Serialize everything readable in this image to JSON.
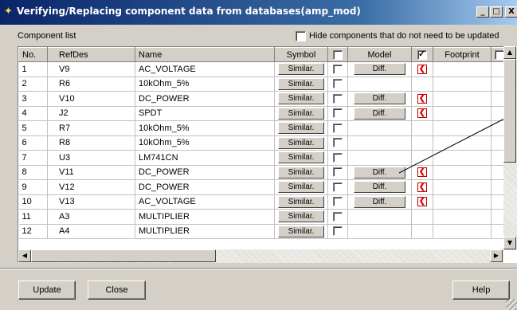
{
  "window": {
    "title": "Verifying/Replacing component data from databases(amp_mod)",
    "title_icon": "tools-icon",
    "minimize": "_",
    "maximize": "□",
    "close": "X"
  },
  "list_label": "Component list",
  "hide_checkbox_label": "Hide components that do not need to be updated",
  "columns": [
    "No.",
    "RefDes",
    "Name",
    "Symbol",
    "",
    "Model",
    "",
    "Footprint",
    ""
  ],
  "rows": [
    {
      "no": "1",
      "refdes": "V9",
      "name": "AC_VOLTAGE",
      "symbol": "Similar.",
      "model": "Diff.",
      "model_flag": true
    },
    {
      "no": "2",
      "refdes": "R6",
      "name": "10kOhm_5%",
      "symbol": "Similar.",
      "model": "",
      "model_flag": false
    },
    {
      "no": "3",
      "refdes": "V10",
      "name": "DC_POWER",
      "symbol": "Similar.",
      "model": "Diff.",
      "model_flag": true
    },
    {
      "no": "4",
      "refdes": "J2",
      "name": "SPDT",
      "symbol": "Similar.",
      "model": "Diff.",
      "model_flag": true
    },
    {
      "no": "5",
      "refdes": "R7",
      "name": "10kOhm_5%",
      "symbol": "Similar.",
      "model": "",
      "model_flag": false
    },
    {
      "no": "6",
      "refdes": "R8",
      "name": "10kOhm_5%",
      "symbol": "Similar.",
      "model": "",
      "model_flag": false
    },
    {
      "no": "7",
      "refdes": "U3",
      "name": "LM741CN",
      "symbol": "Similar.",
      "model": "",
      "model_flag": false
    },
    {
      "no": "8",
      "refdes": "V11",
      "name": "DC_POWER",
      "symbol": "Similar.",
      "model": "Diff.",
      "model_flag": true
    },
    {
      "no": "9",
      "refdes": "V12",
      "name": "DC_POWER",
      "symbol": "Similar.",
      "model": "Diff.",
      "model_flag": true
    },
    {
      "no": "10",
      "refdes": "V13",
      "name": "AC_VOLTAGE",
      "symbol": "Similar.",
      "model": "Diff.",
      "model_flag": true
    },
    {
      "no": "11",
      "refdes": "A3",
      "name": "MULTIPLIER",
      "symbol": "Similar.",
      "model": "",
      "model_flag": false
    },
    {
      "no": "12",
      "refdes": "A4",
      "name": "MULTIPLIER",
      "symbol": "Similar.",
      "model": "",
      "model_flag": false
    }
  ],
  "buttons": {
    "update": "Update",
    "close": "Close",
    "help": "Help"
  }
}
